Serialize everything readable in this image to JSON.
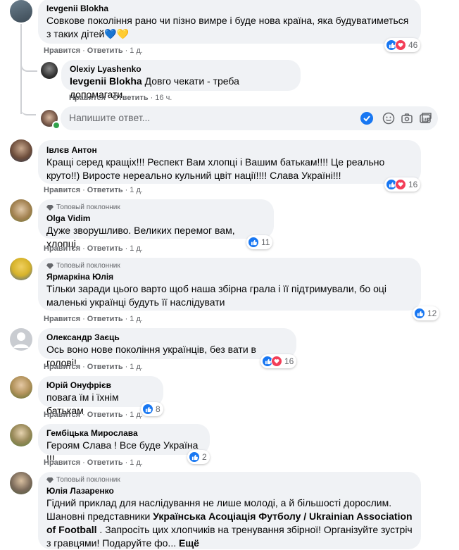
{
  "actions": {
    "like": "Нравится",
    "reply": "Ответить",
    "sep": "·"
  },
  "fan_badge": "Топовый поклонник",
  "reply_input": {
    "placeholder": "Напишите ответ..."
  },
  "comments": [
    {
      "name": "Ievgenii Blokha",
      "text": "Совкове покоління рано чи пізно вимре і буде нова країна, яка будуватиметься з таких дітей💙💛",
      "time": "1 д.",
      "reactions": "46"
    },
    {
      "name": "Olexiy Lyashenko",
      "mention": "Ievgenii Blokha",
      "text": "Довго чекати - треба допомагати",
      "time": "16 ч."
    },
    {
      "name": "Івлєв Антон",
      "text": "Кращі серед кращіх!!! Респект Вам хлопці і Вашим батькам!!!! Це реально круто!!) Виросте нереально кульний цвіт нації!!!! Слава Україні!!!",
      "time": "1 д.",
      "reactions": "16"
    },
    {
      "name": "Olga Vidim",
      "text": "Дуже зворушливо. Великих перемог вам, хлопці.",
      "time": "1 д.",
      "reactions": "11"
    },
    {
      "name": "Ярмаркіна Юлія",
      "text": "Тільки заради цього варто щоб наша збірна грала і її підтримували, бо оці маленькі українці будуть її наслідувати",
      "time": "1 д.",
      "reactions": "12"
    },
    {
      "name": "Олександр Заєць",
      "text": "Ось воно нове покоління українців, без вати в голові!",
      "time": "1 д.",
      "reactions": "16"
    },
    {
      "name": "Юрій Онуфрієв",
      "text": "повага їм і їхнім батькам",
      "time": "1 д.",
      "reactions": "8"
    },
    {
      "name": "Гембіцька Мирослава",
      "text": "Героям Слава ! Все буде Україна !!!",
      "time": "1 д.",
      "reactions": "2"
    },
    {
      "name": "Юлія Лазаренко",
      "text1": "Гідний приклад для наслідування не лише молоді, а й більшості дорослим.",
      "text2a": "Шановні представники ",
      "text2b": "Українська Асоціація Футболу / Ukrainian Association of Football",
      "text2c": " . Запросіть цих хлопчиків на тренування збірної! Організуйте зустріч з гравцями! Подаруйте фо... ",
      "more": "Ещё"
    }
  ]
}
